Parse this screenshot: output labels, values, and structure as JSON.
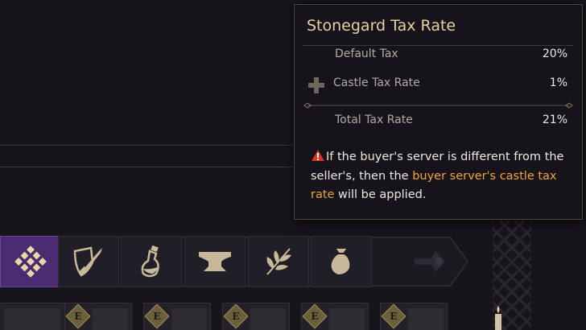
{
  "tooltip": {
    "title": "Stonegard Tax Rate",
    "default_tax_label": "Default Tax",
    "default_tax_value": "20%",
    "castle_tax_label": "Castle Tax Rate",
    "castle_tax_value": "1%",
    "total_tax_label": "Total Tax Rate",
    "total_tax_value": "21%",
    "note_part1": "If the buyer's server is different from the seller's, then the ",
    "note_highlight": "buyer server's castle tax rate",
    "note_part2": " will be applied.",
    "highlight_color": "#f0a53a",
    "title_color": "#e8cfa3"
  },
  "categories": [
    {
      "name": "all",
      "icon": "diamond-grid-icon",
      "active": true
    },
    {
      "name": "weapons",
      "icon": "sword-shield-icon",
      "active": false
    },
    {
      "name": "potions",
      "icon": "potion-icon",
      "active": false
    },
    {
      "name": "crafting",
      "icon": "anvil-icon",
      "active": false
    },
    {
      "name": "materials",
      "icon": "leaf-icon",
      "active": false
    },
    {
      "name": "bag",
      "icon": "pouch-icon",
      "active": false
    }
  ],
  "item_slots": [
    {
      "grade": ""
    },
    {
      "grade": "E"
    },
    {
      "grade": "E"
    },
    {
      "grade": "E"
    },
    {
      "grade": "E"
    },
    {
      "grade": "E"
    }
  ],
  "accent_color": "#4a2a70"
}
